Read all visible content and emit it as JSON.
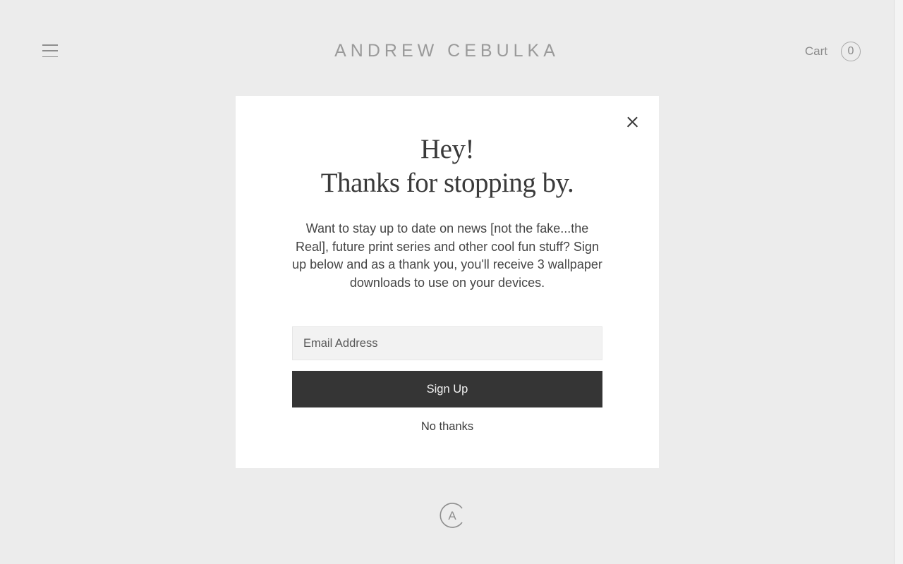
{
  "header": {
    "menu_icon": "hamburger-menu-icon",
    "brand": "ANDREW CEBULKA",
    "cart_label": "Cart",
    "cart_count": "0"
  },
  "modal": {
    "title_line1": "Hey!",
    "title_line2": "Thanks for stopping by.",
    "body": "Want to stay up to date on news [not the fake...the Real], future print series and other cool fun stuff? Sign up below and as a thank you, you'll receive 3 wallpaper downloads to use on your devices.",
    "email_placeholder": "Email Address",
    "email_value": "",
    "signup_label": "Sign Up",
    "no_thanks_label": "No thanks",
    "close_icon": "close-icon"
  },
  "footer": {
    "logo_icon": "monogram-logo-icon",
    "logo_letter": "A"
  },
  "colors": {
    "page_background": "#ececec",
    "modal_background": "#ffffff",
    "button_background": "#353535",
    "input_background": "#f2f2f2"
  }
}
